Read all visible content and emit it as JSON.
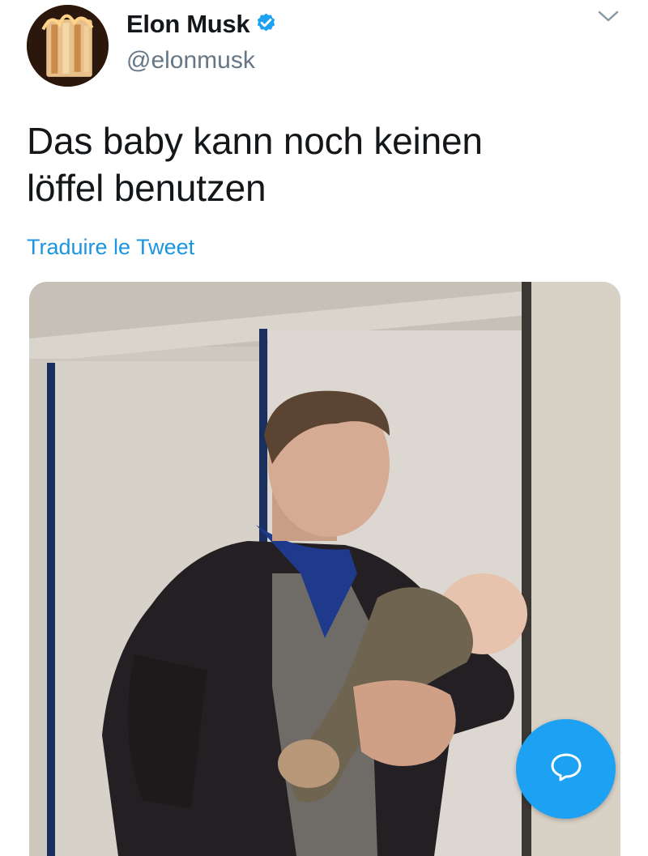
{
  "user": {
    "display_name": "Elon Musk",
    "handle": "@elonmusk",
    "verified": true
  },
  "tweet": {
    "text_line1": "Das baby kann noch keinen",
    "text_line2": "löffel benutzen",
    "translate_link": "Traduire le Tweet"
  },
  "icons": {
    "verified": "verified-badge-icon",
    "menu": "chevron-down-icon",
    "compose": "speech-bubble-icon"
  },
  "colors": {
    "accent": "#1da1f2",
    "link": "#1b95e0",
    "text": "#14171a",
    "secondary": "#657786"
  }
}
